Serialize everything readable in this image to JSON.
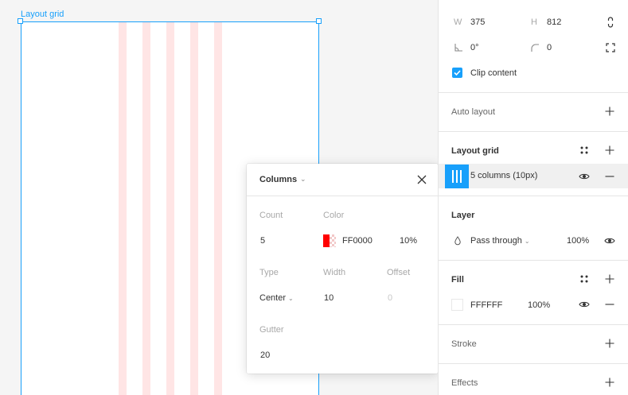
{
  "canvas": {
    "frame_label": "Layout grid",
    "grid_color": "#FFE5E5",
    "selection_color": "#18A0FB"
  },
  "popover": {
    "title": "Columns",
    "count_label": "Count",
    "count_value": "5",
    "color_label": "Color",
    "color_hex": "FF0000",
    "color_opacity": "10%",
    "color_swatch": "#FF0000",
    "type_label": "Type",
    "type_value": "Center",
    "width_label": "Width",
    "width_value": "10",
    "offset_label": "Offset",
    "offset_value": "0",
    "gutter_label": "Gutter",
    "gutter_value": "20"
  },
  "panel": {
    "w_label": "W",
    "w_value": "375",
    "h_label": "H",
    "h_value": "812",
    "rotation_value": "0°",
    "radius_value": "0",
    "clip_content": "Clip content",
    "auto_layout": "Auto layout",
    "layout_grid": "Layout grid",
    "grid_item": "5 columns (10px)",
    "layer": "Layer",
    "blend_mode": "Pass through",
    "layer_opacity": "100%",
    "fill": "Fill",
    "fill_hex": "FFFFFF",
    "fill_opacity": "100%",
    "stroke": "Stroke",
    "effects": "Effects"
  },
  "icons": [
    "constrain-proportions-icon",
    "rotation-icon",
    "corner-radius-icon",
    "independent-corners-icon",
    "checkbox-checked-icon",
    "plus-icon",
    "grid-styles-icon",
    "columns-grid-icon",
    "eye-icon",
    "minus-icon",
    "blend-drop-icon",
    "chevron-down-icon",
    "close-icon"
  ]
}
